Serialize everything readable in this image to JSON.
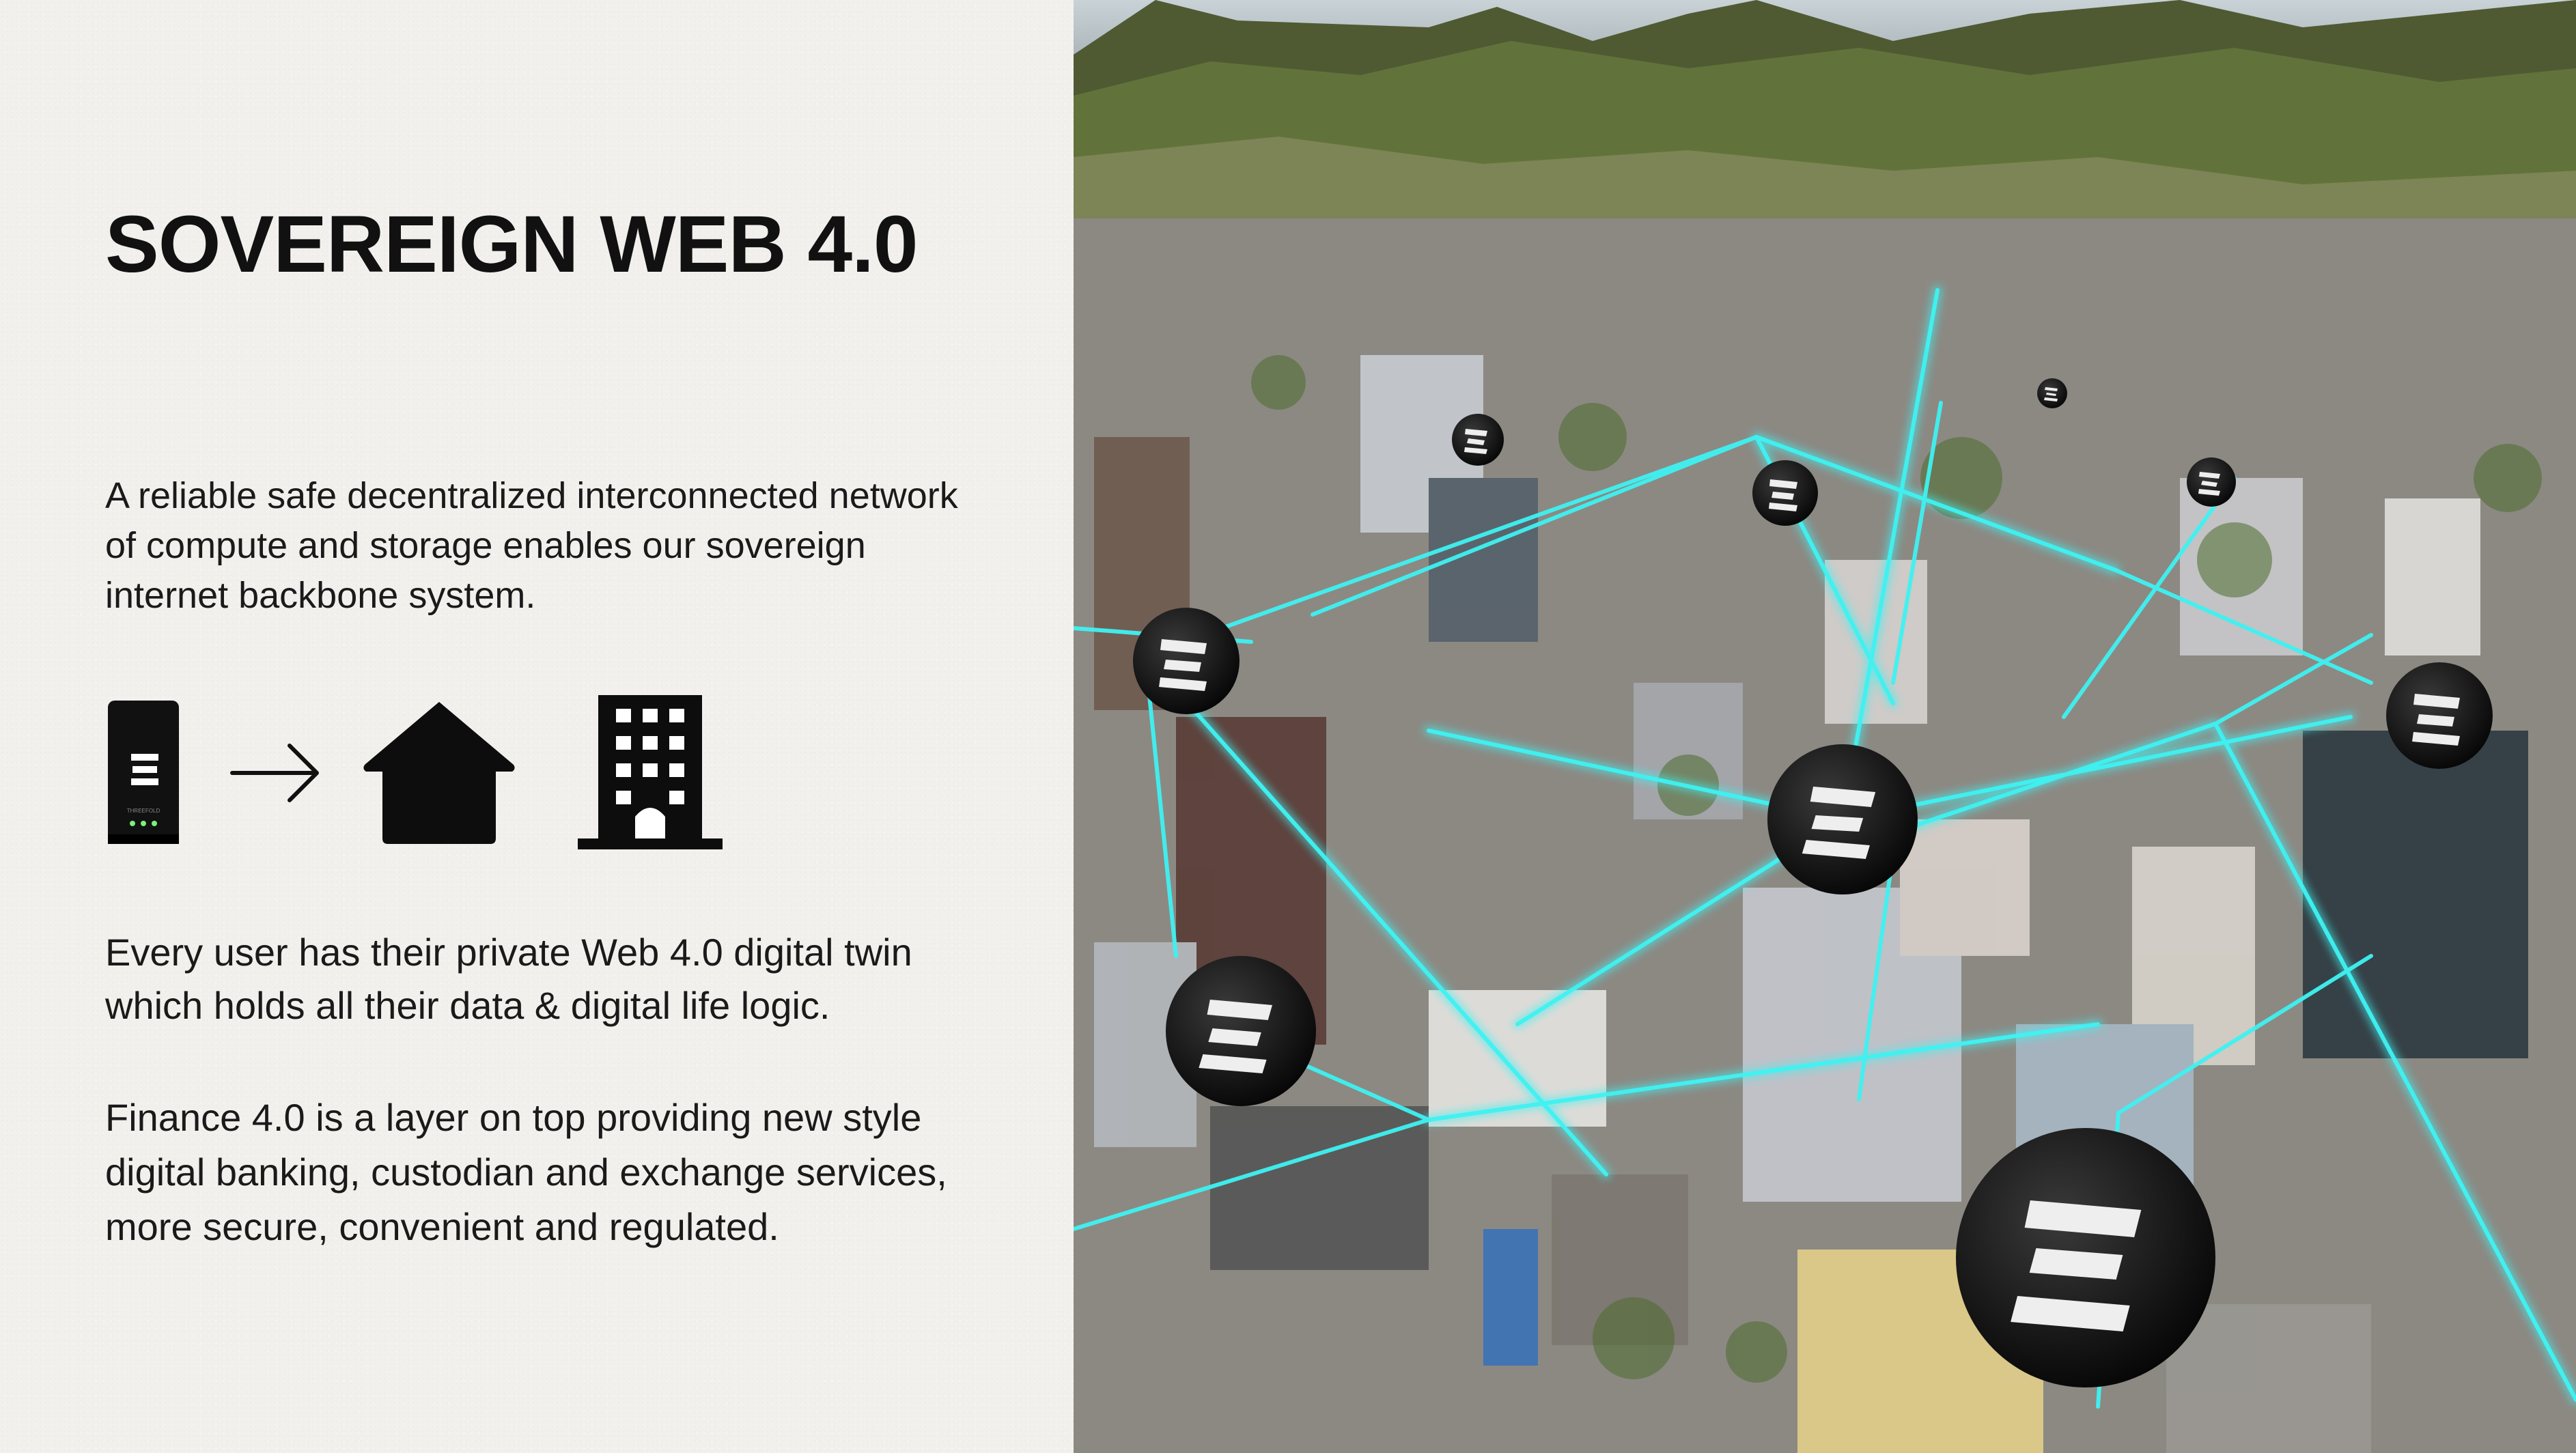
{
  "title": "SOVEREIGN WEB 4.0",
  "paragraph_1": "A reliable safe decentralized interconnected network of compute and storage enables our sovereign internet backbone system.",
  "paragraph_2": "Every user has their private Web 4.0 digital twin which holds all their data & digital life logic.",
  "paragraph_3": "Finance 4.0 is a layer on top providing new style digital banking, custodian and exchange services, more secure, convenient and regulated.",
  "icons": [
    "server-device-icon",
    "arrow-right-icon",
    "house-icon",
    "office-building-icon"
  ],
  "photo": {
    "subject": "aerial city with connected network node spheres",
    "node_color": "#1b1b1b",
    "link_color": "#3ff2f2"
  }
}
